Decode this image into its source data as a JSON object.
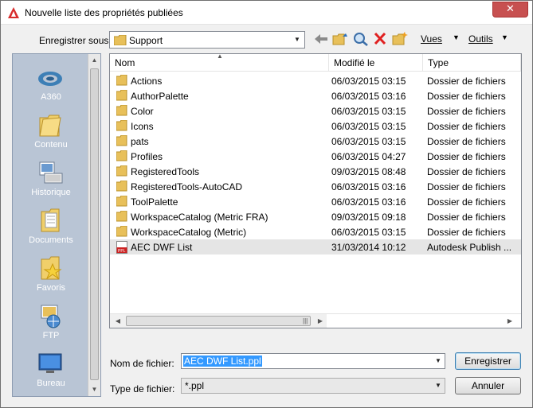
{
  "window": {
    "title": "Nouvelle liste des propriétés publiées",
    "close_label": "✕"
  },
  "toolbar": {
    "save_in_label": "Enregistrer sous:",
    "save_in_value": "Support",
    "views_label": "Vues",
    "tools_label": "Outils"
  },
  "places": [
    {
      "label": "A360",
      "icon": "a360-icon"
    },
    {
      "label": "Contenu",
      "icon": "content-folder-icon"
    },
    {
      "label": "Historique",
      "icon": "history-icon"
    },
    {
      "label": "Documents",
      "icon": "documents-folder-icon"
    },
    {
      "label": "Favoris",
      "icon": "favorites-folder-icon"
    },
    {
      "label": "FTP",
      "icon": "ftp-icon"
    },
    {
      "label": "Bureau",
      "icon": "desktop-icon"
    }
  ],
  "filelist": {
    "columns": [
      "Nom",
      "Modifié le",
      "Type"
    ],
    "rows": [
      {
        "name": "Actions",
        "modified": "06/03/2015 03:15",
        "type": "Dossier de fichiers",
        "icon": "folder-icon"
      },
      {
        "name": "AuthorPalette",
        "modified": "06/03/2015 03:16",
        "type": "Dossier de fichiers",
        "icon": "folder-icon"
      },
      {
        "name": "Color",
        "modified": "06/03/2015 03:15",
        "type": "Dossier de fichiers",
        "icon": "folder-icon"
      },
      {
        "name": "Icons",
        "modified": "06/03/2015 03:15",
        "type": "Dossier de fichiers",
        "icon": "folder-icon"
      },
      {
        "name": "pats",
        "modified": "06/03/2015 03:15",
        "type": "Dossier de fichiers",
        "icon": "folder-icon"
      },
      {
        "name": "Profiles",
        "modified": "06/03/2015 04:27",
        "type": "Dossier de fichiers",
        "icon": "folder-icon"
      },
      {
        "name": "RegisteredTools",
        "modified": "09/03/2015 08:48",
        "type": "Dossier de fichiers",
        "icon": "folder-icon"
      },
      {
        "name": "RegisteredTools-AutoCAD",
        "modified": "06/03/2015 03:16",
        "type": "Dossier de fichiers",
        "icon": "folder-icon"
      },
      {
        "name": "ToolPalette",
        "modified": "06/03/2015 03:16",
        "type": "Dossier de fichiers",
        "icon": "folder-icon"
      },
      {
        "name": "WorkspaceCatalog (Metric FRA)",
        "modified": "09/03/2015 09:18",
        "type": "Dossier de fichiers",
        "icon": "folder-icon"
      },
      {
        "name": "WorkspaceCatalog (Metric)",
        "modified": "06/03/2015 03:15",
        "type": "Dossier de fichiers",
        "icon": "folder-icon"
      },
      {
        "name": "AEC DWF List",
        "modified": "31/03/2014 10:12",
        "type": "Autodesk Publish ...",
        "icon": "ppl-file-icon"
      }
    ]
  },
  "fields": {
    "filename_label": "Nom de fichier:",
    "filename_value": "AEC DWF List.ppl",
    "filetype_label": "Type de fichier:",
    "filetype_value": "*.ppl"
  },
  "buttons": {
    "save": "Enregistrer",
    "cancel": "Annuler"
  }
}
